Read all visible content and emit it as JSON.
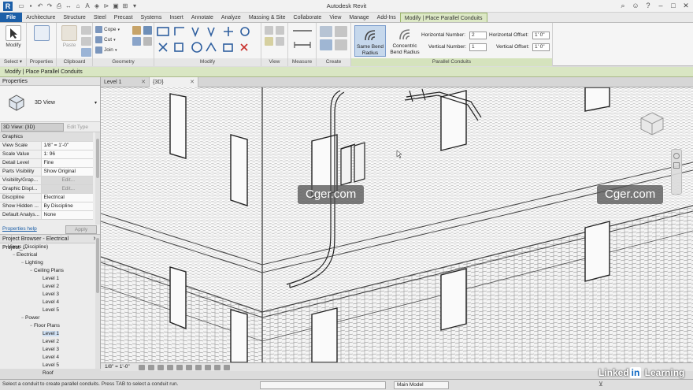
{
  "app": {
    "title": "Autodesk Revit",
    "icon_letter": "R"
  },
  "tabs": [
    {
      "label": "File",
      "type": "file"
    },
    {
      "label": "Architecture"
    },
    {
      "label": "Structure"
    },
    {
      "label": "Steel"
    },
    {
      "label": "Precast"
    },
    {
      "label": "Systems"
    },
    {
      "label": "Insert"
    },
    {
      "label": "Annotate"
    },
    {
      "label": "Analyze"
    },
    {
      "label": "Massing & Site"
    },
    {
      "label": "Collaborate"
    },
    {
      "label": "View"
    },
    {
      "label": "Manage"
    },
    {
      "label": "Add-Ins"
    },
    {
      "label": "Modify | Place Parallel Conduits",
      "active": true
    }
  ],
  "ribbon": {
    "select": {
      "modify_label": "Modify",
      "panel_label": "Select ▾"
    },
    "properties": {
      "panel_label": "Properties"
    },
    "clipboard": {
      "panel_label": "Clipboard",
      "paste_label": "Paste"
    },
    "geometry": {
      "panel_label": "Geometry",
      "cope": "Cope",
      "cut": "Cut",
      "join": "Join"
    },
    "modify": {
      "panel_label": "Modify"
    },
    "view": {
      "panel_label": "View"
    },
    "measure": {
      "panel_label": "Measure"
    },
    "create": {
      "panel_label": "Create"
    },
    "parallel": {
      "panel_label": "Parallel Conduits",
      "same_bend": "Same Bend Radius",
      "concentric_bend": "Concentric Bend Radius",
      "horizontal_number_label": "Horizontal Number:",
      "horizontal_number": "2",
      "vertical_number_label": "Vertical Number:",
      "vertical_number": "1",
      "horizontal_offset_label": "Horizontal Offset:",
      "horizontal_offset": "1' 0\"",
      "vertical_offset_label": "Vertical Offset:",
      "vertical_offset": "1' 0\""
    }
  },
  "context_bar": "Modify | Place Parallel Conduits",
  "properties": {
    "title": "Properties",
    "type_name": "3D View",
    "view_selector": "3D View: {3D}",
    "edit_type": "Edit Type",
    "group": "Graphics",
    "rows": [
      {
        "k": "View Scale",
        "v": "1/8\" = 1'-0\""
      },
      {
        "k": "Scale Value",
        "v": "1:  96"
      },
      {
        "k": "Detail Level",
        "v": "Fine"
      },
      {
        "k": "Parts Visibility",
        "v": "Show Original"
      },
      {
        "k": "Visibility/Grap...",
        "v": "Edit...",
        "btn": true
      },
      {
        "k": "Graphic Displ...",
        "v": "Edit...",
        "btn": true
      },
      {
        "k": "Discipline",
        "v": "Electrical"
      },
      {
        "k": "Show Hidden ...",
        "v": "By Discipline"
      },
      {
        "k": "Default Analys...",
        "v": "None"
      }
    ],
    "help_link": "Properties help",
    "apply": "Apply"
  },
  "project_browser": {
    "title": "Project Browser - Electrical Project_...",
    "nodes": [
      {
        "label": "Views (Discipline)",
        "level": 0,
        "toggle": "−"
      },
      {
        "label": "Electrical",
        "level": 1,
        "toggle": "−"
      },
      {
        "label": "Lighting",
        "level": 2,
        "toggle": "−"
      },
      {
        "label": "Ceiling Plans",
        "level": 3,
        "toggle": "−"
      },
      {
        "label": "Level 1",
        "level": 4
      },
      {
        "label": "Level 2",
        "level": 4
      },
      {
        "label": "Level 3",
        "level": 4
      },
      {
        "label": "Level 4",
        "level": 4
      },
      {
        "label": "Level 5",
        "level": 4
      },
      {
        "label": "Power",
        "level": 2,
        "toggle": "−"
      },
      {
        "label": "Floor Plans",
        "level": 3,
        "toggle": "−"
      },
      {
        "label": "Level 1",
        "level": 4,
        "selected": true
      },
      {
        "label": "Level 2",
        "level": 4
      },
      {
        "label": "Level 3",
        "level": 4
      },
      {
        "label": "Level 4",
        "level": 4
      },
      {
        "label": "Level 5",
        "level": 4
      },
      {
        "label": "Roof",
        "level": 4
      }
    ]
  },
  "view_tabs": [
    {
      "label": "Level 1"
    },
    {
      "label": "{3D}",
      "active": true
    }
  ],
  "watermark": "Cger.com",
  "view_control": {
    "scale": "1/8\" = 1'-0\""
  },
  "status": {
    "message": "Select a conduit to create parallel conduits. Press TAB to select a conduit run.",
    "model": "Main Model"
  },
  "linkedin": {
    "pre": "Linked",
    "in": "in",
    "post": " Learning"
  },
  "colors": {
    "file_tab": "#1c5fa8",
    "context_tab": "#dce8c5",
    "selection": "#cfe0f3"
  }
}
